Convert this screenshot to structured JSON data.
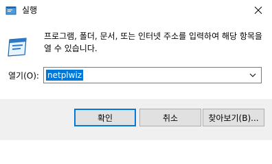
{
  "window": {
    "title": "실행",
    "close_glyph": "✕"
  },
  "dialog": {
    "description": "프로그램, 폴더, 문서, 또는 인터넷 주소를 입력하여 해당 항목을 열 수 있습니다.",
    "open_label": "열기(O):",
    "open_value": "netplwiz",
    "selection_color": "#0078d7"
  },
  "buttons": {
    "ok": "확인",
    "cancel": "취소",
    "browse": "찾아보기(B)..."
  },
  "icons": {
    "app": "run-icon",
    "close": "close-icon",
    "dropdown": "chevron-down-icon"
  }
}
